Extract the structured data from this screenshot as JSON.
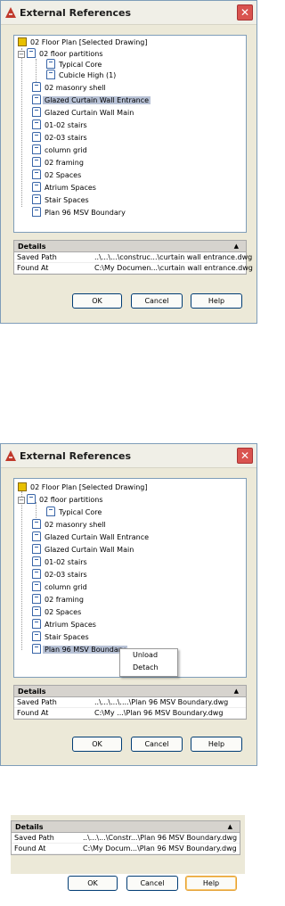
{
  "colors": {
    "title_bar": "#f0efe7",
    "close": "#d9534f",
    "selection": "#b8c2d6",
    "dialog_bg": "#ece9d8"
  },
  "dialog1": {
    "title": "External References",
    "tree": [
      {
        "label": "02 Floor Plan [Selected Drawing]",
        "icon": "drawing-root-icon"
      },
      {
        "label": "02 floor partitions",
        "icon": "xref-icon"
      },
      {
        "label": "Typical Core",
        "icon": "xref-icon"
      },
      {
        "label": "Cubicle High (1)",
        "icon": "xref-icon"
      },
      {
        "label": "02 masonry shell",
        "icon": "xref-icon"
      },
      {
        "label": "Glazed Curtain Wall Entrance",
        "icon": "xref-icon"
      },
      {
        "label": "Glazed Curtain Wall Main",
        "icon": "xref-icon"
      },
      {
        "label": "01-02 stairs",
        "icon": "xref-icon"
      },
      {
        "label": "02-03 stairs",
        "icon": "xref-icon"
      },
      {
        "label": "column grid",
        "icon": "xref-icon"
      },
      {
        "label": "02 framing",
        "icon": "xref-icon"
      },
      {
        "label": "02 Spaces",
        "icon": "xref-icon"
      },
      {
        "label": "Atrium Spaces",
        "icon": "xref-icon"
      },
      {
        "label": "Stair Spaces",
        "icon": "xref-icon"
      },
      {
        "label": "Plan 96 MSV Boundary",
        "icon": "xref-icon"
      }
    ],
    "details": {
      "header": "Details",
      "rows": [
        {
          "key": "Saved Path",
          "value": "..\\...\\...\\construc...\\curtain wall entrance.dwg"
        },
        {
          "key": "Found At",
          "value": "C:\\My Documen...\\curtain wall entrance.dwg"
        }
      ]
    },
    "buttons": {
      "ok": "OK",
      "cancel": "Cancel",
      "help": "Help"
    }
  },
  "dialog2": {
    "title": "External References",
    "tree": [
      {
        "label": "02 Floor Plan [Selected Drawing]",
        "icon": "drawing-root-icon"
      },
      {
        "label": "02 floor partitions",
        "icon": "xref-icon"
      },
      {
        "label": "Typical Core",
        "icon": "xref-icon"
      },
      {
        "label": "02 masonry shell",
        "icon": "xref-icon"
      },
      {
        "label": "Glazed Curtain Wall Entrance",
        "icon": "xref-icon"
      },
      {
        "label": "Glazed Curtain Wall Main",
        "icon": "xref-icon"
      },
      {
        "label": "01-02 stairs",
        "icon": "xref-icon"
      },
      {
        "label": "02-03 stairs",
        "icon": "xref-icon"
      },
      {
        "label": "column grid",
        "icon": "xref-icon"
      },
      {
        "label": "02 framing",
        "icon": "xref-icon"
      },
      {
        "label": "02 Spaces",
        "icon": "xref-icon"
      },
      {
        "label": "Atrium Spaces",
        "icon": "xref-icon"
      },
      {
        "label": "Stair Spaces",
        "icon": "xref-icon"
      },
      {
        "label": "Plan 96 MSV Boundary",
        "icon": "xref-icon"
      }
    ],
    "context_menu": {
      "unload": "Unload",
      "detach": "Detach"
    },
    "details": {
      "header": "Details",
      "rows": [
        {
          "key": "Saved Path",
          "value": "..\\...\\...\\....\\Plan 96 MSV Boundary.dwg"
        },
        {
          "key": "Found At",
          "value": "C:\\My ...\\Plan 96 MSV Boundary.dwg"
        }
      ]
    },
    "buttons": {
      "ok": "OK",
      "cancel": "Cancel",
      "help": "Help"
    }
  },
  "panel3": {
    "details": {
      "header": "Details",
      "rows": [
        {
          "key": "Saved Path",
          "value": "..\\...\\...\\Constr...\\Plan 96 MSV Boundary.dwg"
        },
        {
          "key": "Found At",
          "value": "C:\\My Docum...\\Plan 96 MSV Boundary.dwg"
        }
      ]
    },
    "buttons": {
      "ok": "OK",
      "cancel": "Cancel",
      "help": "Help"
    }
  }
}
